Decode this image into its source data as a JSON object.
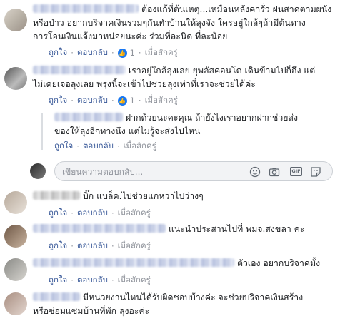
{
  "actions": {
    "like": "ถูกใจ",
    "reply": "ตอบกลับ",
    "separator": "·"
  },
  "comments": [
    {
      "line1": "ต้องแก้ที่ต้นเหตุ...เหมือนหลังคารั่ว ฝนสาดตามผนัง",
      "line2": "หรือป่าว อยากบริจาคเงินรวมๆกันทำบ้านให้ลุงจัง ใครอยู่ใกล้ๆถ้ามีต้นทาง",
      "line3": "การโอนเงินแจ้งมาหน่อยนะค่ะ ร่วมที่ละนิด ที่ละน้อย",
      "like_count": "1",
      "time": "เมื่อสักครู่"
    },
    {
      "line1": "เราอยู่ใกล้ลุงเลย ยุพลัสคอนโด เดินข้ามไปก็ถึง แต่",
      "line2": "ไม่เคยเจอลุงเลย พรุ่งนี้จะเข้าไปช่วยลุงเท่าที่เราจะช่วยได้ค่ะ",
      "like_count": "1",
      "time": "เมื่อสักครู่"
    },
    {
      "line1": "ฝากด้วยนะคะคุณ ถ้ายังไงเราอยากฝากช่วยส่ง",
      "line2": "ของให้ลุงอีกทางนึง แต่ไม่รู้จะส่งไปไหน",
      "time": "เมื่อสักครู่"
    },
    {
      "line1": "บิ๊ก แบล็ค.ไปช่วยแกหวาไปว่างๆ",
      "time": "เมื่อสักครู่"
    },
    {
      "line1": "แนะนำประสานไปที่ พมจ.สงขลา ค่ะ",
      "time": "เมื่อสักครู่"
    },
    {
      "line1": "ตัวเอง อยากบริจาคมั้ง",
      "time": "เมื่อสักครู่"
    },
    {
      "line1": "มีหน่วยงานไหนได้รับผิดชอบบ้างค่ะ จะช่วยบริจาคเงินสร้าง",
      "line2": "หรือซ่อมแซมบ้านที่พัก ลุงอะค่ะ"
    }
  ],
  "reply_box": {
    "placeholder": "เขียนความตอบกลับ...",
    "icons": [
      "emoji-icon",
      "camera-icon",
      "gif-icon",
      "sticker-icon"
    ],
    "gif_label": "GIF"
  },
  "colors": {
    "link": "#385898",
    "meta": "#90949c",
    "like_badge": "#1877f2"
  }
}
